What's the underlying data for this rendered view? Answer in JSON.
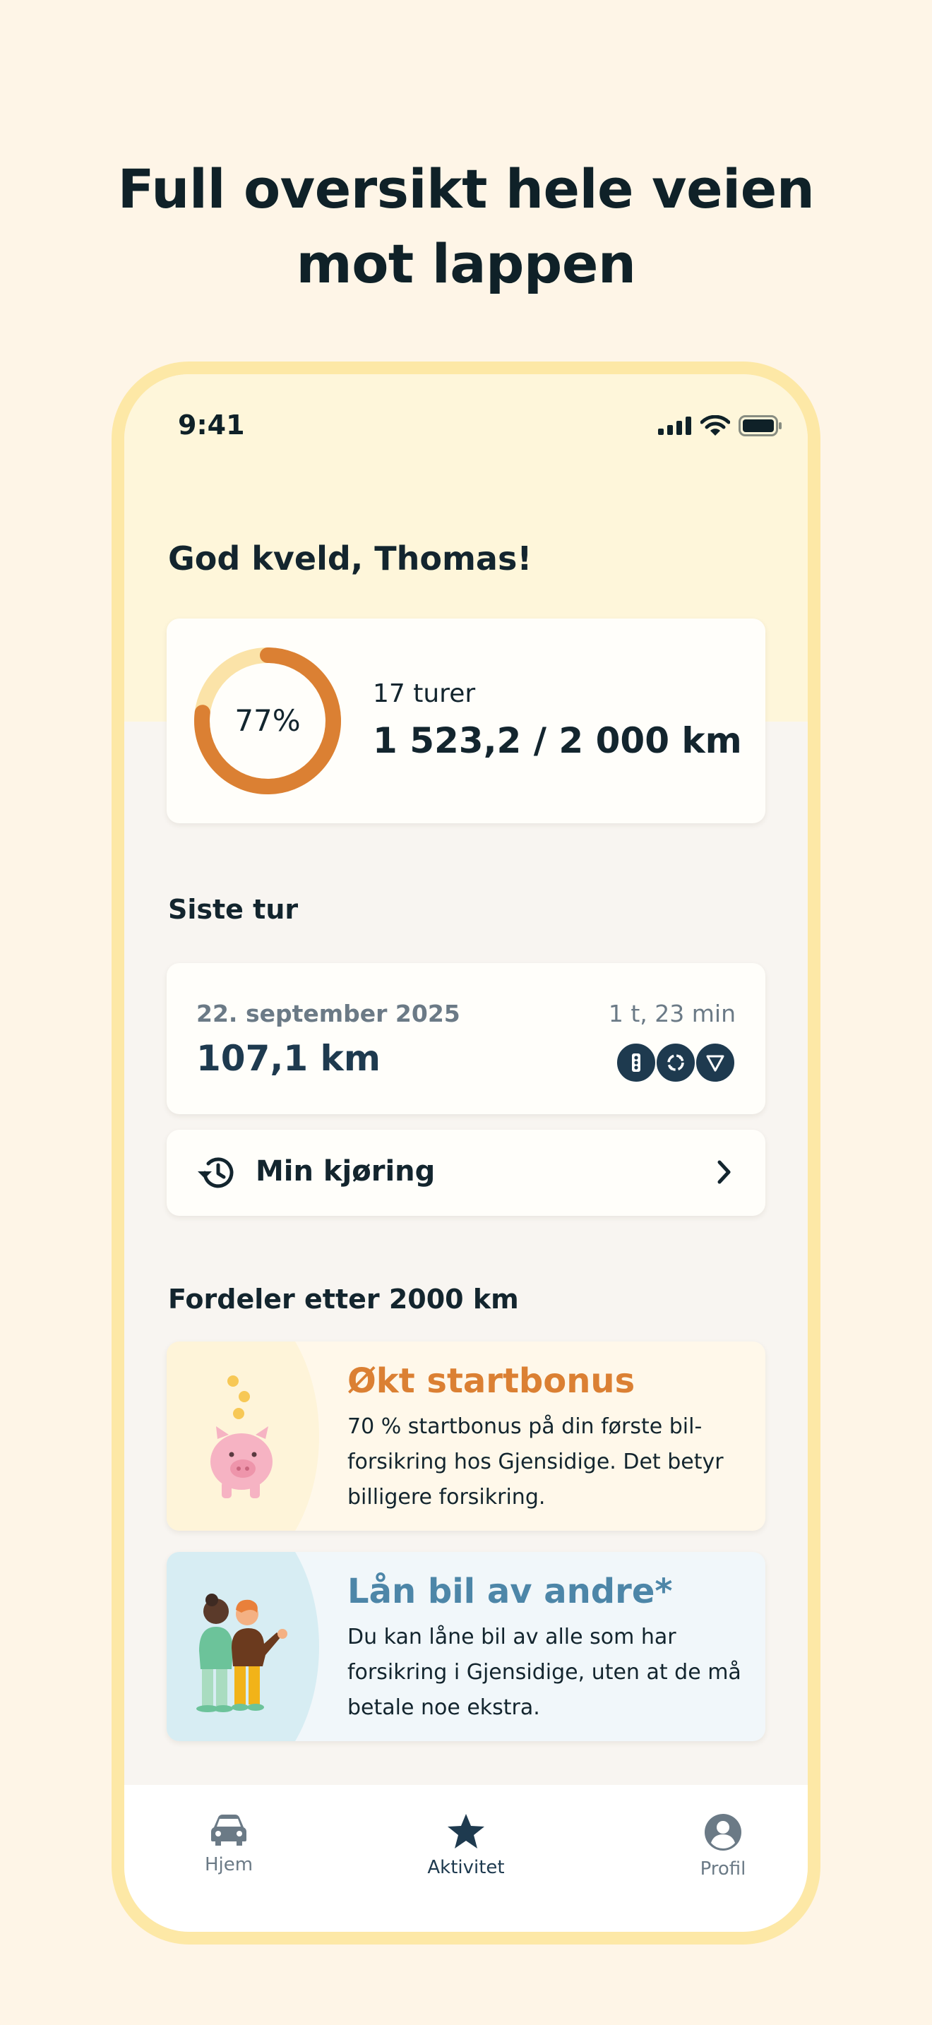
{
  "headline": {
    "line1": "Full oversikt hele veien",
    "line2": "mot lappen"
  },
  "status_bar": {
    "time": "9:41"
  },
  "greeting": "God kveld, Thomas!",
  "progress": {
    "percent_label": "77%",
    "percent_value": 0.77,
    "trips": "17 turer",
    "distance": "1 523,2 / 2 000 km"
  },
  "last_trip": {
    "section_title": "Siste tur",
    "date": "22. september 2025",
    "distance": "107,1 km",
    "duration": "1 t, 23 min",
    "badge_icons": [
      "traffic-light-icon",
      "roundabout-icon",
      "yield-sign-icon"
    ]
  },
  "my_driving": {
    "label": "Min kjøring",
    "icon": "history-icon"
  },
  "benefits": {
    "section_title": "Fordeler etter 2000 km",
    "items": [
      {
        "title": "Økt startbonus",
        "text": "70 % startbonus på din første bil-forsikring hos Gjensidige. Det betyr billigere forsikring.",
        "icon": "piggy-bank-icon"
      },
      {
        "title": "Lån bil av andre*",
        "text": "Du kan låne bil av alle som har forsikring i Gjensidige, uten at de må betale noe ekstra.",
        "icon": "people-illustration"
      }
    ]
  },
  "tabs": [
    {
      "label": "Hjem",
      "icon": "car-icon",
      "active": false
    },
    {
      "label": "Aktivitet",
      "icon": "star-icon",
      "active": true
    },
    {
      "label": "Profil",
      "icon": "profile-icon",
      "active": false
    }
  ],
  "colors": {
    "accent": "#DB8033",
    "navy": "#1E3A4F",
    "frame": "#FDE8A6",
    "donut_track": "#FBE3A8"
  }
}
